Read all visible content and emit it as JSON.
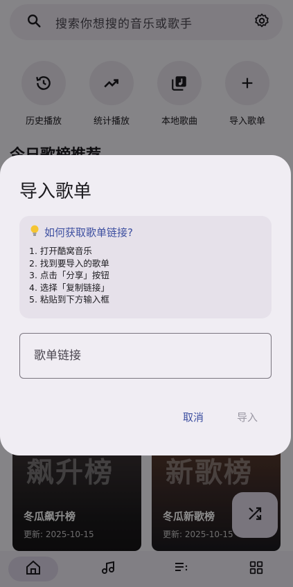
{
  "search": {
    "placeholder": "搜索你想搜的音乐或歌手"
  },
  "quick_actions": [
    {
      "label": "历史播放",
      "icon": "history-icon"
    },
    {
      "label": "统计播放",
      "icon": "trending-up-icon"
    },
    {
      "label": "本地歌曲",
      "icon": "library-music-icon"
    },
    {
      "label": "导入歌单",
      "icon": "plus-icon"
    }
  ],
  "section": {
    "title": "今日歌榜推荐"
  },
  "cards": [
    {
      "big_text": "飙升榜",
      "name": "冬瓜飙升榜",
      "updated": "更新: 2025-10-15"
    },
    {
      "big_text": "新歌榜",
      "name": "冬瓜新歌榜",
      "updated": "更新: 2025-10-15"
    }
  ],
  "bottom_nav": [
    {
      "icon": "home-icon",
      "active": true
    },
    {
      "icon": "music-note-icon",
      "active": false
    },
    {
      "icon": "playlist-icon",
      "active": false
    },
    {
      "icon": "grid-icon",
      "active": false
    }
  ],
  "dialog": {
    "title": "导入歌单",
    "help_title": "如何获取歌单链接?",
    "steps": [
      "1. 打开酷窝音乐",
      "2. 找到要导入的歌单",
      "3. 点击「分享」按钮",
      "4. 选择「复制链接」",
      "5. 粘贴到下方输入框"
    ],
    "input_placeholder": "歌单链接",
    "input_value": "",
    "cancel_label": "取消",
    "import_label": "导入"
  },
  "colors": {
    "accent": "#3d4fa0",
    "disabled": "#9a97a3",
    "surface": "#f0edf3"
  }
}
